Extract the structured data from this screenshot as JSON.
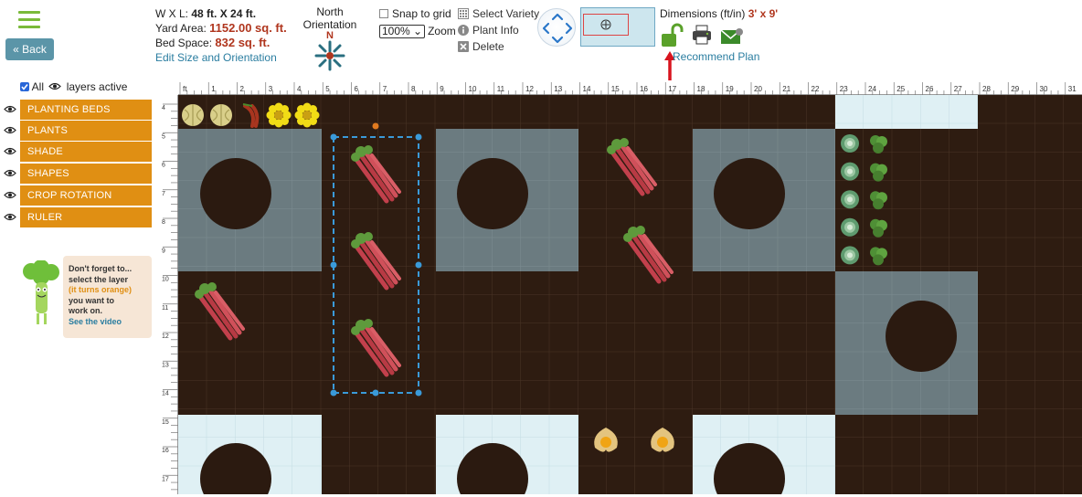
{
  "toolbar": {
    "back_label": "« Back",
    "wxl_label": "W X L:",
    "wxl_value": "48 ft. X 24 ft.",
    "yard_area_label": "Yard Area:",
    "yard_area_value": "1152.00 sq. ft.",
    "bed_space_label": "Bed Space:",
    "bed_space_value": "832 sq. ft.",
    "edit_link": "Edit Size and Orientation",
    "north_label": "North Orientation",
    "north_letter": "N",
    "snap_label": "Snap to grid",
    "zoom_value": "100%",
    "zoom_label": "Zoom",
    "select_variety": "Select Variety",
    "plant_info": "Plant Info",
    "delete": "Delete",
    "dimensions_label": "Dimensions (ft/in)",
    "dimensions_value": "3' x 9'",
    "recommend_plan": "Recommend Plan"
  },
  "layers": {
    "all_label": "All",
    "active_label": "layers active",
    "items": [
      "PLANTING BEDS",
      "PLANTS",
      "SHADE",
      "SHAPES",
      "CROP ROTATION",
      "RULER"
    ]
  },
  "tip": {
    "line1": "Don't forget to...",
    "line2": "select the layer",
    "line3": "(it turns orange)",
    "line4": "you want to",
    "line5": "work on.",
    "video_link": "See the video"
  },
  "ruler": {
    "top_numbers": [
      "ft",
      "1",
      "2",
      "3",
      "4",
      "5",
      "6",
      "7",
      "8",
      "9",
      "10",
      "11",
      "12",
      "13",
      "14",
      "15",
      "16",
      "17",
      "18",
      "19",
      "20",
      "21",
      "22",
      "23",
      "24",
      "25",
      "26",
      "27",
      "28",
      "29",
      "30",
      "31"
    ],
    "left_numbers": [
      "4",
      "5",
      "6",
      "7",
      "8",
      "9",
      "10",
      "11",
      "12",
      "13",
      "14",
      "15",
      "16",
      "17"
    ]
  },
  "colors": {
    "accent_orange": "#e08f13",
    "value_red": "#b0361e",
    "link_blue": "#2a7da0",
    "soil": "#2b1a10",
    "shade_gray": "#6b7b80",
    "path_light": "#dff0f4"
  },
  "plants": {
    "top_row": [
      "melon",
      "melon",
      "chili",
      "sunflower",
      "sunflower"
    ],
    "selected_bed": [
      "rhubarb",
      "rhubarb",
      "rhubarb"
    ],
    "other": [
      "rhubarb",
      "rhubarb",
      "rhubarb",
      "cabbage",
      "lettuce",
      "physalis"
    ]
  }
}
